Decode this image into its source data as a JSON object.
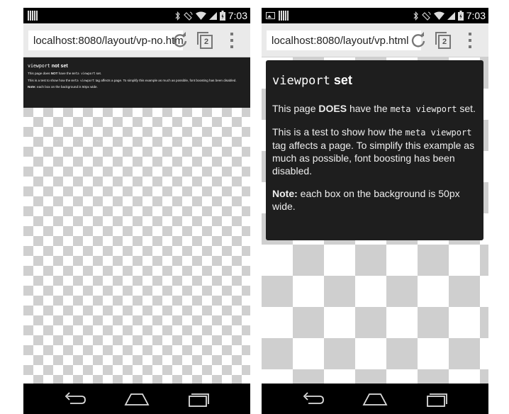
{
  "left": {
    "status": {
      "time": "7:03"
    },
    "url": "localhost:8080/layout/vp-no.htm",
    "tab_count": "2",
    "card": {
      "title_code": "viewport",
      "title_text": "not set",
      "p1_before": "This page does ",
      "p1_strong": "NOT",
      "p1_mid": " have the ",
      "p1_code": "meta viewport",
      "p1_after": " set.",
      "p2_before": "This is a test to show how the ",
      "p2_code": "meta viewport",
      "p2_after": " tag affects a page. To simplify this example as much as possible, font boosting has been disabled.",
      "note_label": "Note:",
      "note_text": " each box on the background is 50px wide."
    }
  },
  "right": {
    "status": {
      "time": "7:03"
    },
    "url": "localhost:8080/layout/vp.html",
    "tab_count": "2",
    "card": {
      "title_code": "viewport",
      "title_text": "set",
      "p1_before": "This page ",
      "p1_strong": "DOES",
      "p1_mid": " have the ",
      "p1_code": "meta viewport",
      "p1_after": " set.",
      "p2_before": "This is a test to show how the ",
      "p2_code": "meta viewport",
      "p2_after": " tag affects a page. To simplify this example as much as possible, font boosting has been disabled.",
      "note_label": "Note:",
      "note_text": " each box on the background is 50px wide."
    }
  },
  "icons": {
    "status": [
      "signal-bars-icon",
      "image-icon",
      "bluetooth-icon",
      "rotation-icon",
      "wifi-icon",
      "cell-signal-icon",
      "battery-icon"
    ],
    "toolbar": [
      "reload-icon",
      "tabs-icon",
      "overflow-menu-icon"
    ],
    "nav": [
      "back-icon",
      "home-icon",
      "recents-icon"
    ]
  }
}
